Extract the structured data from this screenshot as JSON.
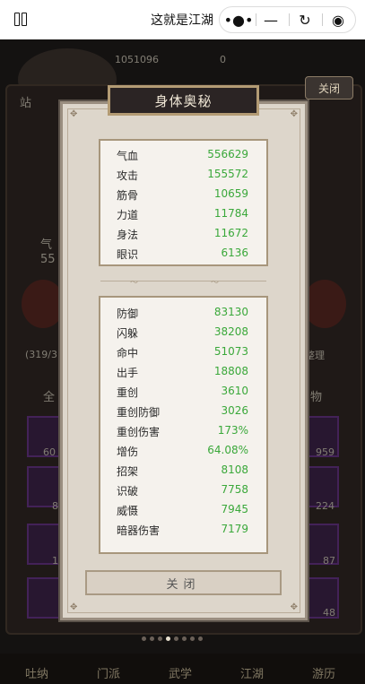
{
  "topbar": {
    "title": "这就是江湖",
    "menu_icon": "more-dots-icon",
    "min_icon": "minimize-icon",
    "share_icon": "share-icon",
    "close_icon": "target-icon"
  },
  "background": {
    "player_id": "1051096",
    "currency": "0",
    "top_close": "关闭",
    "left_tag": "站",
    "left_stat_label": "气",
    "left_stat_value": "55",
    "progress_text": "(319/3",
    "right_button": "整理",
    "filter_left": "全",
    "filter_right": "物",
    "slot_counts": [
      "60",
      "8",
      "1",
      "959",
      "224",
      "87",
      "48"
    ],
    "nav": [
      "吐纳",
      "门派",
      "武学",
      "江湖",
      "游历"
    ]
  },
  "modal": {
    "title": "身体奥秘",
    "close_label": "关闭",
    "primary_stats": [
      {
        "label": "气血",
        "value": "556629"
      },
      {
        "label": "攻击",
        "value": "155572"
      },
      {
        "label": "筋骨",
        "value": "10659"
      },
      {
        "label": "力道",
        "value": "11784"
      },
      {
        "label": "身法",
        "value": "11672"
      },
      {
        "label": "眼识",
        "value": "6136"
      }
    ],
    "secondary_stats": [
      {
        "label": "防御",
        "value": "83130"
      },
      {
        "label": "闪躲",
        "value": "38208"
      },
      {
        "label": "命中",
        "value": "51073"
      },
      {
        "label": "出手",
        "value": "18808"
      },
      {
        "label": "重创",
        "value": "3610"
      },
      {
        "label": "重创防御",
        "value": "3026"
      },
      {
        "label": "重创伤害",
        "value": "173%"
      },
      {
        "label": "增伤",
        "value": "64.08%"
      },
      {
        "label": "招架",
        "value": "8108"
      },
      {
        "label": "识破",
        "value": "7758"
      },
      {
        "label": "威慑",
        "value": "7945"
      },
      {
        "label": "暗器伤害",
        "value": "7179"
      }
    ]
  },
  "colors": {
    "stat_value": "#3aa83a",
    "panel": "#ddd6cb",
    "title_bg": "#2b2424"
  }
}
